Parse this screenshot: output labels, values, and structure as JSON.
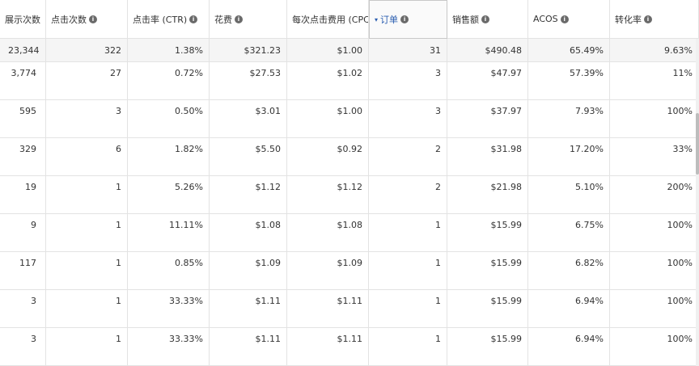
{
  "headers": [
    {
      "label": "展示次数",
      "info": false
    },
    {
      "label": "点击次数",
      "info": true
    },
    {
      "label": "点击率 (CTR)",
      "info": true
    },
    {
      "label": "花费",
      "info": true
    },
    {
      "label": "每次点击费用 (CPC)",
      "info": false
    },
    {
      "label": "订单",
      "info": true,
      "sorted": true
    },
    {
      "label": "销售额",
      "info": true
    },
    {
      "label": "ACOS",
      "info": true
    },
    {
      "label": "转化率",
      "info": true
    }
  ],
  "info_glyph": "i",
  "sort_glyph": "▾",
  "totals": [
    "23,344",
    "322",
    "1.38%",
    "$321.23",
    "$1.00",
    "31",
    "$490.48",
    "65.49%",
    "9.63%"
  ],
  "rows": [
    [
      "3,774",
      "27",
      "0.72%",
      "$27.53",
      "$1.02",
      "3",
      "$47.97",
      "57.39%",
      "11%"
    ],
    [
      "595",
      "3",
      "0.50%",
      "$3.01",
      "$1.00",
      "3",
      "$37.97",
      "7.93%",
      "100%"
    ],
    [
      "329",
      "6",
      "1.82%",
      "$5.50",
      "$0.92",
      "2",
      "$31.98",
      "17.20%",
      "33%"
    ],
    [
      "19",
      "1",
      "5.26%",
      "$1.12",
      "$1.12",
      "2",
      "$21.98",
      "5.10%",
      "200%"
    ],
    [
      "9",
      "1",
      "11.11%",
      "$1.08",
      "$1.08",
      "1",
      "$15.99",
      "6.75%",
      "100%"
    ],
    [
      "117",
      "1",
      "0.85%",
      "$1.09",
      "$1.09",
      "1",
      "$15.99",
      "6.82%",
      "100%"
    ],
    [
      "3",
      "1",
      "33.33%",
      "$1.11",
      "$1.11",
      "1",
      "$15.99",
      "6.94%",
      "100%"
    ],
    [
      "3",
      "1",
      "33.33%",
      "$1.11",
      "$1.11",
      "1",
      "$15.99",
      "6.94%",
      "100%"
    ]
  ],
  "colors": {
    "sorted_header": "#2a5db0",
    "border": "#e3e3e3",
    "totals_bg": "#f5f5f5"
  }
}
